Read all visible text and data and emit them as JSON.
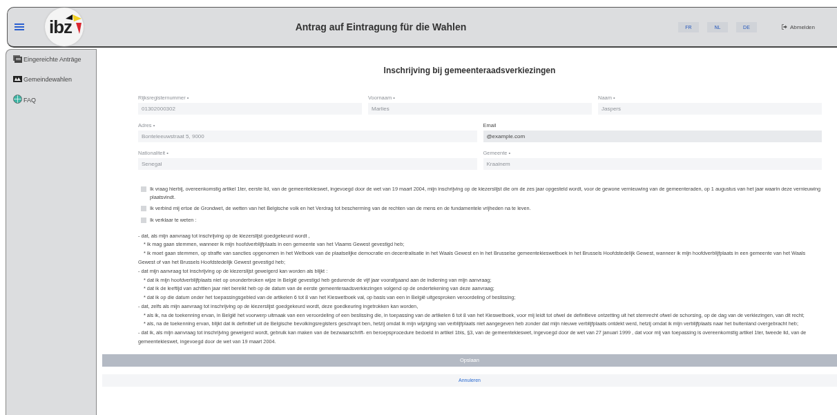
{
  "header": {
    "logo": "ibz",
    "title": "Antrag auf Eintragung für die Wahlen",
    "languages": [
      {
        "label": "FR"
      },
      {
        "label": "NL"
      },
      {
        "label": "DE"
      }
    ],
    "logout": "Abmelden"
  },
  "sidebar": {
    "items": [
      {
        "label": "Eingereichte Anträge",
        "kind": "documents"
      },
      {
        "label": "Gemeindewahlen",
        "kind": "ballot"
      },
      {
        "label": "FAQ",
        "kind": "faq"
      }
    ]
  },
  "form": {
    "title": "Inschrijving bij gemeenteraadsverkiezingen",
    "rows": [
      [
        {
          "label": "Rijksregisternummer •",
          "value": "01302000302",
          "disabled": true
        },
        {
          "label": "Voornaam •",
          "value": "Marlies",
          "disabled": true
        },
        {
          "label": "Naam •",
          "value": "Jaspers",
          "disabled": true
        }
      ],
      [
        {
          "label": "Adres •",
          "value": "Bonteleeuwstraat 5, 9000",
          "disabled": true
        },
        {
          "label": "Email",
          "value": "@example.com",
          "disabled": false
        }
      ],
      [
        {
          "label": "Nationaliteit •",
          "value": "Senegal",
          "disabled": true
        },
        {
          "label": "Gemeente •",
          "value": "Kraainem",
          "disabled": true
        }
      ]
    ],
    "checkboxes": [
      {
        "label": "Ik vraag hierbij, overeenkomstig artikel 1ter, eerste lid, van de gemeentekieswet, ingevoegd door de wet van 19 maart 2004, mijn inschrijving op de kiezerslijst die om de zes jaar opgesteld wordt, voor de gewone vernieuwing van de gemeenteraden, op 1 augustus van het jaar waarin deze vernieuwing plaatsvindt.",
        "checked": false
      },
      {
        "label": "Ik verbind mij ertoe de Grondwet, de wetten van het Belgische volk en het Verdrag tot bescherming van de rechten van de mens en de fundamentele vrijheden na te leven.",
        "checked": false
      },
      {
        "label": "Ik verklaar te weten :",
        "checked": false
      }
    ],
    "statements": [
      {
        "kind": "dash",
        "text": "- dat, als mijn aanvraag tot inschrijving op de kiezerslijst goedgekeurd wordt ,"
      },
      {
        "kind": "star",
        "text": "* ik mag gaan stemmen, wanneer ik mijn hoofdverblijfplaats in een gemeente van het Vlaams Gewest gevestigd heb;"
      },
      {
        "kind": "star",
        "text": "* ik moet gaan stemmen, op straffe van sancties opgenomen in het Wetboek van de plaatselijke democratie en decentralisatie in het Waals Gewest en in het Brusselse gemeentekieswetboek in het Brussels Hoofdstedelijk Gewest, wanneer ik mijn hoofdverblijfplaats in een gemeente van het Waals Gewest of van het Brussels Hoofdstedelijk Gewest gevestigd heb;"
      },
      {
        "kind": "dash",
        "text": "- dat mijn aanvraag tot inschrijving op de kiezerslijst geweigerd kan worden als blijkt :"
      },
      {
        "kind": "star",
        "text": "* dat ik mijn hoofdverblijfplaats niet op ononderbroken wijze in België gevestigd heb gedurende de vijf jaar voorafgaand aan de indiening van mijn aanvraag;"
      },
      {
        "kind": "star",
        "text": "* dat ik de leeftijd van achttien jaar niet bereikt heb op de datum van de eerste gemeenteraadsverkiezingen volgend op de ondertekening van deze aanvraag;"
      },
      {
        "kind": "star",
        "text": "* dat ik op die datum onder het toepassingsgebied van de artikelen 6 tot 8 van het Kieswetboek val, op basis van een in België uitgesproken veroordeling of beslissing;"
      },
      {
        "kind": "dash",
        "text": "- dat, zelfs als mijn aanvraag tot inschrijving op de kiezerslijst goedgekeurd wordt, deze goedkeuring ingetrokken kan worden,"
      },
      {
        "kind": "star",
        "text": "* als ik, na de toekenning ervan, in België het voorwerp uitmaak van een veroordeling of een beslissing die, in toepassing van de artikelen 6 tot 8 van het Kieswetboek, voor mij leidt tot ofwel de definitieve ontzetting uit het stemrecht ofwel de schorsing, op de dag van de verkiezingen, van dit recht;"
      },
      {
        "kind": "star",
        "text": "* als, na de toekenning ervan, blijkt dat ik definitief uit de Belgische bevolkingsregisters geschrapt ben, hetzij omdat ik mijn wijziging van verblijfplaats niet aangegeven heb zonder dat mijn nieuwe verblijfplaats ontdekt werd, hetzij omdat ik mijn verblijfplaats naar het buitenland overgebracht heb;"
      },
      {
        "kind": "dash",
        "text": "- dat ik, als mijn aanvraag tot inschrijving geweigerd wordt, gebruik kan maken van de bezwaarschrift- en beroepsprocedure bedoeld in artikel 1bis, §3, van de gemeentekieswet, ingevoegd door de wet van 27 januari 1999 , dat voor mij van toepassing is overeenkomstig artikel 1ter, tweede lid, van de gemeentekieswet, ingevoegd door de wet van 19 maart 2004."
      }
    ],
    "save": {
      "label": "Opslaan",
      "disabled": true
    },
    "cancel": {
      "label": "Annuleren"
    }
  }
}
